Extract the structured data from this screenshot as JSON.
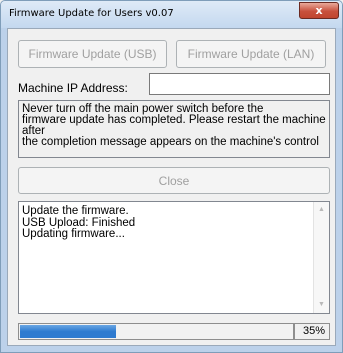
{
  "window": {
    "title": "Firmware Update for Users v0.07",
    "close_glyph": "x"
  },
  "buttons": {
    "usb_label": "Firmware Update (USB)",
    "lan_label": "Firmware Update (LAN)",
    "close_label": "Close"
  },
  "ip": {
    "label": "Machine IP Address:",
    "value": ""
  },
  "warning": {
    "lines": [
      "Never turn off the main power switch before the",
      "firmware update has completed. Please restart the machine",
      "after",
      "the completion message appears on the machine's control"
    ]
  },
  "log": {
    "lines": [
      "Update the firmware.",
      "USB Upload: Finished",
      "Updating firmware..."
    ]
  },
  "progress": {
    "percent": 35,
    "label": "35%"
  },
  "colors": {
    "progress_fill": "#2e7bd0",
    "close_button": "#c8513d"
  }
}
